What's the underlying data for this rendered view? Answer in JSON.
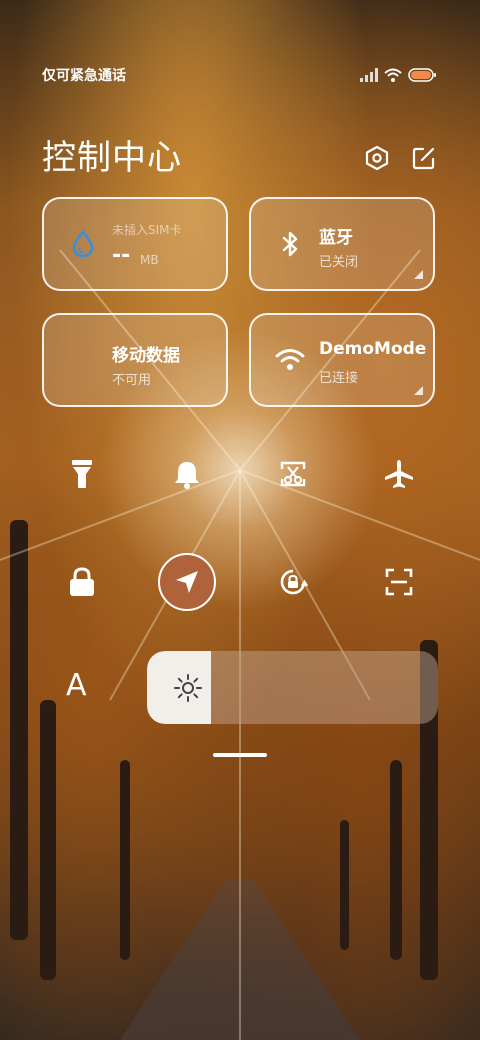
{
  "status_bar": {
    "carrier": "仅可紧急通话"
  },
  "header": {
    "title": "控制中心"
  },
  "tiles": {
    "data": {
      "line1": "未插入SIM卡",
      "value": "--",
      "unit": "MB"
    },
    "bluetooth": {
      "label": "蓝牙",
      "status": "已关闭"
    },
    "mobile_data": {
      "label": "移动数据",
      "status": "不可用"
    },
    "wifi": {
      "label": "DemoMode",
      "status": "已连接"
    }
  },
  "font_size_label": "A",
  "brightness": {
    "level": 0.22
  },
  "colors": {
    "location_active": "#b0633a",
    "tile_border": "#ffffff",
    "drop_icon": "#3a8fd8"
  }
}
